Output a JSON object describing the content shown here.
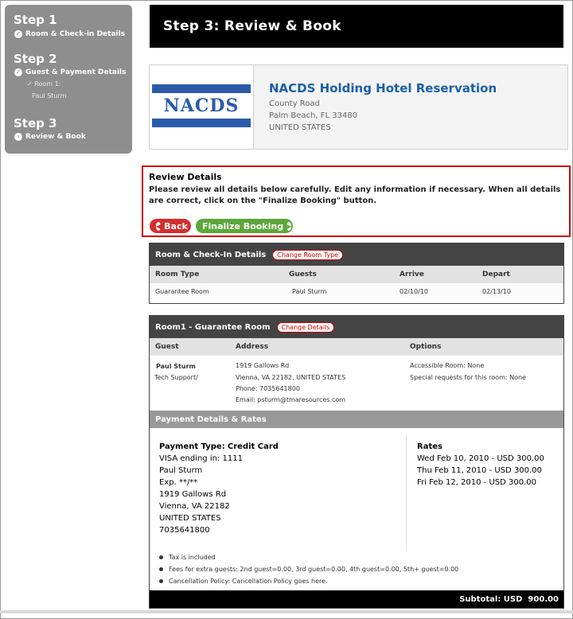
{
  "sidebar": {
    "step1": {
      "title": "Step 1",
      "item": "Room & Check-in Details"
    },
    "step2": {
      "title": "Step 2",
      "item": "Guest & Payment Details",
      "sub1": "Room 1:",
      "sub2": "Paul Sturm"
    },
    "step3": {
      "title": "Step 3",
      "item": "Review & Book"
    }
  },
  "header": {
    "title": "Step 3: Review & Book"
  },
  "hotel": {
    "logo_text": "NACDS",
    "name": "NACDS Holding Hotel Reservation",
    "address1": "County Road",
    "address2": "Palm Beach, FL 33480",
    "address3": "UNITED STATES"
  },
  "review": {
    "title": "Review Details",
    "description": "Please review all details below carefully. Edit any information if necessary. When all details are correct, click on the \"Finalize Booking\" button.",
    "back_label": "Back",
    "finalize_label": "Finalize Booking"
  },
  "room_checkin": {
    "title": "Room & Check-In Details",
    "change_label": "Change Room Type",
    "headers": {
      "room_type": "Room Type",
      "guests": "Guests",
      "arrive": "Arrive",
      "depart": "Depart"
    },
    "row": {
      "room_type": "Guarantee Room",
      "guests": "Paul Sturm",
      "arrive": "02/10/10",
      "depart": "02/13/10"
    }
  },
  "room1": {
    "title": "Room1 - Guarantee Room",
    "change_label": "Change Details",
    "headers": {
      "guest": "Guest",
      "address": "Address",
      "options": "Options"
    },
    "guest_name": "Paul Sturm",
    "guest_role": "Tech Support/",
    "address_line1": "1919 Gallows Rd",
    "address_line2": "Vienna, VA 22182, UNITED STATES",
    "phone": "Phone: 7035641800",
    "email": "Email: psturm@tmaresources.com",
    "option1": "Accessible Room: None",
    "option2": "Special requests for this room: None"
  },
  "payment": {
    "section_title": "Payment Details & Rates",
    "type_label": "Payment Type:",
    "type_value": "Credit Card",
    "card": "VISA ending in: 1111",
    "name": "Paul Sturm",
    "exp": "Exp. **/**",
    "addr1": "1919 Gallows Rd",
    "addr2": "Vienna, VA 22182",
    "country": "UNITED STATES",
    "phone": "7035641800",
    "rates_title": "Rates",
    "rate1": "Wed Feb 10, 2010 - USD 300.00",
    "rate2": "Thu Feb 11, 2010 - USD 300.00",
    "rate3": "Fri Feb 12, 2010 - USD 300.00"
  },
  "notes": [
    "Tax is included",
    "Fees for extra guests: 2nd guest=0.00, 3rd guest=0.00, 4th guest=0.00, 5th+ guest=0.00",
    "Cancellation Policy: Cancellation Policy goes here."
  ],
  "subtotal": {
    "label": "Subtotal: USD",
    "value": "900.00"
  },
  "colors": {
    "accent_blue": "#1a5fa8",
    "back_red": "#d32f2f",
    "finalize_green": "#5aa83a",
    "header_black": "#000000"
  }
}
